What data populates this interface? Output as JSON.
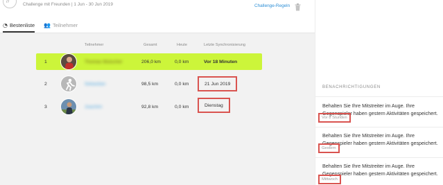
{
  "header": {
    "subtitle": "Challenge mit Freunden  |  1 Jun - 30 Jun 2019",
    "rules_link": "Challenge-Regeln"
  },
  "tabs": [
    {
      "label": "Bestenliste",
      "icon": "trophy-icon",
      "active": true
    },
    {
      "label": "Teilnehmer",
      "icon": "people-icon",
      "active": false
    }
  ],
  "table": {
    "columns": [
      "Teilnehmer",
      "Gesamt",
      "Heute",
      "Letzte Synchronisierung"
    ],
    "rows": [
      {
        "rank": "1",
        "name": "Thomas Mutscher",
        "total": "206,0 km",
        "today": "0,0 km",
        "last_sync": "Vor 18 Minuten"
      },
      {
        "rank": "2",
        "name": "Sebastian",
        "total": "98,5 km",
        "today": "0,0 km",
        "last_sync": "21 Jun 2019"
      },
      {
        "rank": "3",
        "name": "Joachim",
        "total": "92,8 km",
        "today": "0,0 km",
        "last_sync": "Dienstag"
      }
    ]
  },
  "notifications": {
    "heading": "BENACHRICHTIGUNGEN",
    "items": [
      {
        "text": "Behalten Sie Ihre Mitstreiter im Auge. Ihre Gegenspieler haben gestern Aktivitäten gespeichert.",
        "time": "Vor 8 Stunden"
      },
      {
        "text": "Behalten Sie Ihre Mitstreiter im Auge. Ihre Gegenspieler haben gestern Aktivitäten gespeichert.",
        "time": "Gestern"
      },
      {
        "text": "Behalten Sie Ihre Mitstreiter im Auge. Ihre Gegenspieler haben gestern Aktivitäten gespeichert.",
        "time": "Mittwoch"
      }
    ]
  },
  "colors": {
    "leader_highlight": "#ccf53a",
    "annotation_red": "#d9534f",
    "link_blue": "#2d8fd6"
  }
}
